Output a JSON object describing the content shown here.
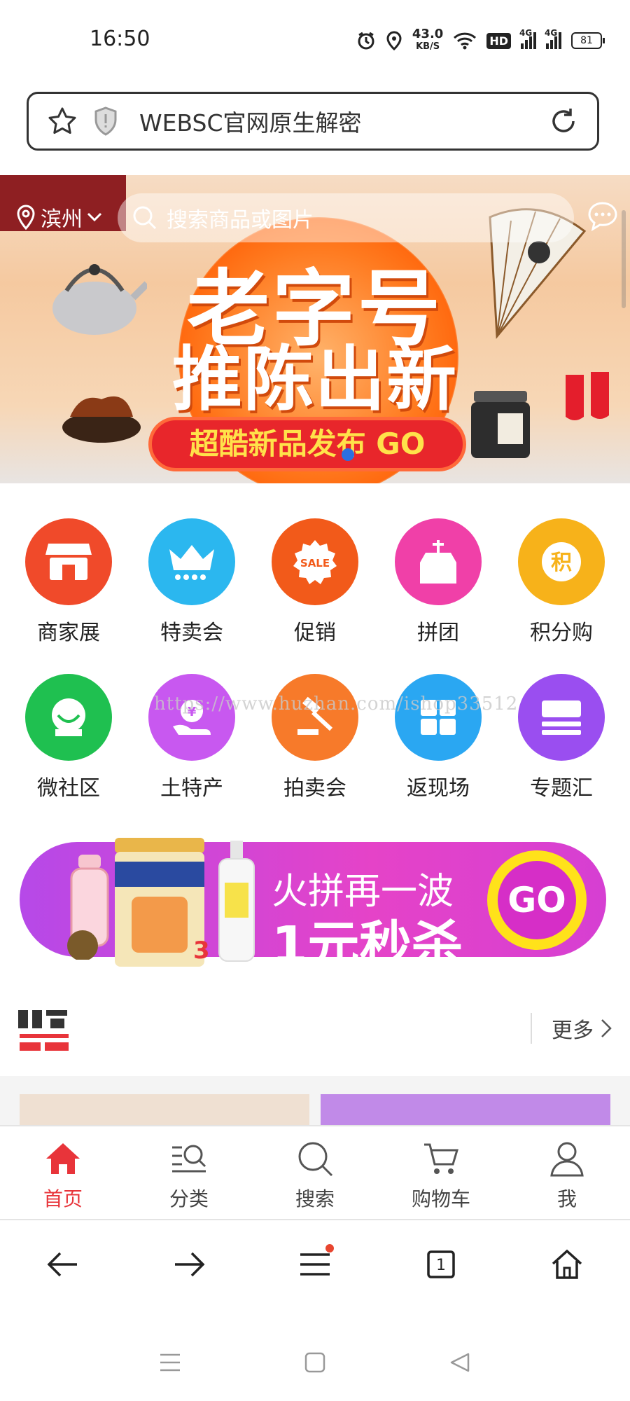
{
  "status": {
    "time": "16:50",
    "net_speed": "43.0",
    "net_unit": "KB/S",
    "hd": "HD",
    "sig1": "4G",
    "sig2": "4G",
    "battery": "81"
  },
  "urlbar": {
    "url": "WEBSC官网原生解密"
  },
  "banner": {
    "location": "滨州",
    "search_placeholder": "搜索商品或图片",
    "headline1": "老字号",
    "headline2": "推陈出新",
    "cta": "超酷新品发布 GO"
  },
  "categories": [
    {
      "label": "商家展",
      "color": "#f04a2a"
    },
    {
      "label": "特卖会",
      "color": "#2bb7ef"
    },
    {
      "label": "促销",
      "color": "#f25a1a"
    },
    {
      "label": "拼团",
      "color": "#f040a8"
    },
    {
      "label": "积分购",
      "color": "#f7b21a"
    },
    {
      "label": "微社区",
      "color": "#1fc050"
    },
    {
      "label": "土特产",
      "color": "#c858f0"
    },
    {
      "label": "拍卖会",
      "color": "#f77a2a"
    },
    {
      "label": "返现场",
      "color": "#2aa7f2"
    },
    {
      "label": "专题汇",
      "color": "#9a4ef0"
    }
  ],
  "watermark": "https://www.huzhan.com/ishop33512",
  "promo": {
    "line1": "火拼再一波",
    "line2": "1元秒杀",
    "go": "GO"
  },
  "hot": {
    "more": "更多"
  },
  "tabs": [
    {
      "label": "首页",
      "icon": "home-icon"
    },
    {
      "label": "分类",
      "icon": "category-icon"
    },
    {
      "label": "搜索",
      "icon": "search-icon"
    },
    {
      "label": "购物车",
      "icon": "cart-icon"
    },
    {
      "label": "我",
      "icon": "user-icon"
    }
  ],
  "browser_nav": {
    "tab_count": "1"
  },
  "colors": {
    "accent": "#e8343a",
    "promo": "#d63fd2"
  }
}
